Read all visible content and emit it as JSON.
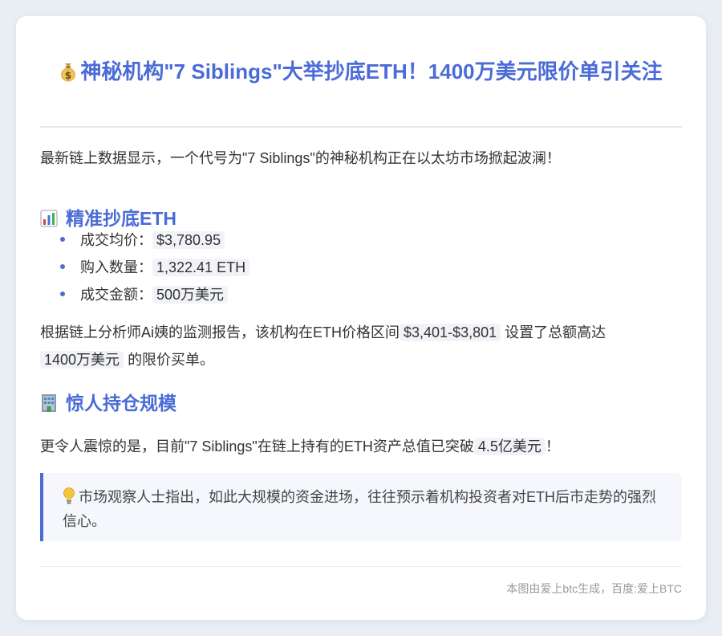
{
  "header": {
    "title": "神秘机构\"7 Siblings\"大举抄底ETH！1400万美元限价单引关注",
    "title_icon": "money-bag-icon"
  },
  "intro": {
    "text": "最新链上数据显示，一个代号为\"7 Siblings\"的神秘机构正在以太坊市场掀起波澜！"
  },
  "section1": {
    "title": "精准抄底ETH",
    "icon": "bar-chart-icon",
    "items": [
      {
        "label": "成交均价：",
        "value": "$3,780.95"
      },
      {
        "label": "购入数量：",
        "value": "1,322.41 ETH"
      },
      {
        "label": "成交金额：",
        "value": "500万美元"
      }
    ]
  },
  "analysis": {
    "part1": "根据链上分析师Ai姨的监测报告，该机构在ETH价格区间",
    "range": "$3,401-$3,801",
    "part2": "设置了总额高达",
    "amount": "1400万美元",
    "part3": "的限价买单。"
  },
  "section2": {
    "title": "惊人持仓规模",
    "icon": "office-building-icon"
  },
  "holdings": {
    "part1": "更令人震惊的是，目前\"7 Siblings\"在链上持有的ETH资产总值已突破",
    "amount": "4.5亿美元",
    "part2": "！"
  },
  "quote": {
    "icon": "light-bulb-icon",
    "text": "市场观察人士指出，如此大规模的资金进场，往往预示着机构投资者对ETH后市走势的强烈信心。"
  },
  "footer": {
    "text": "本图由爱上btc生成，百度:爱上BTC"
  },
  "colors": {
    "accent": "#4b6bd6",
    "background": "#e9edf4",
    "card": "#ffffff",
    "highlight_bg": "#f1f3f8",
    "quote_bg": "#f5f7fc"
  }
}
